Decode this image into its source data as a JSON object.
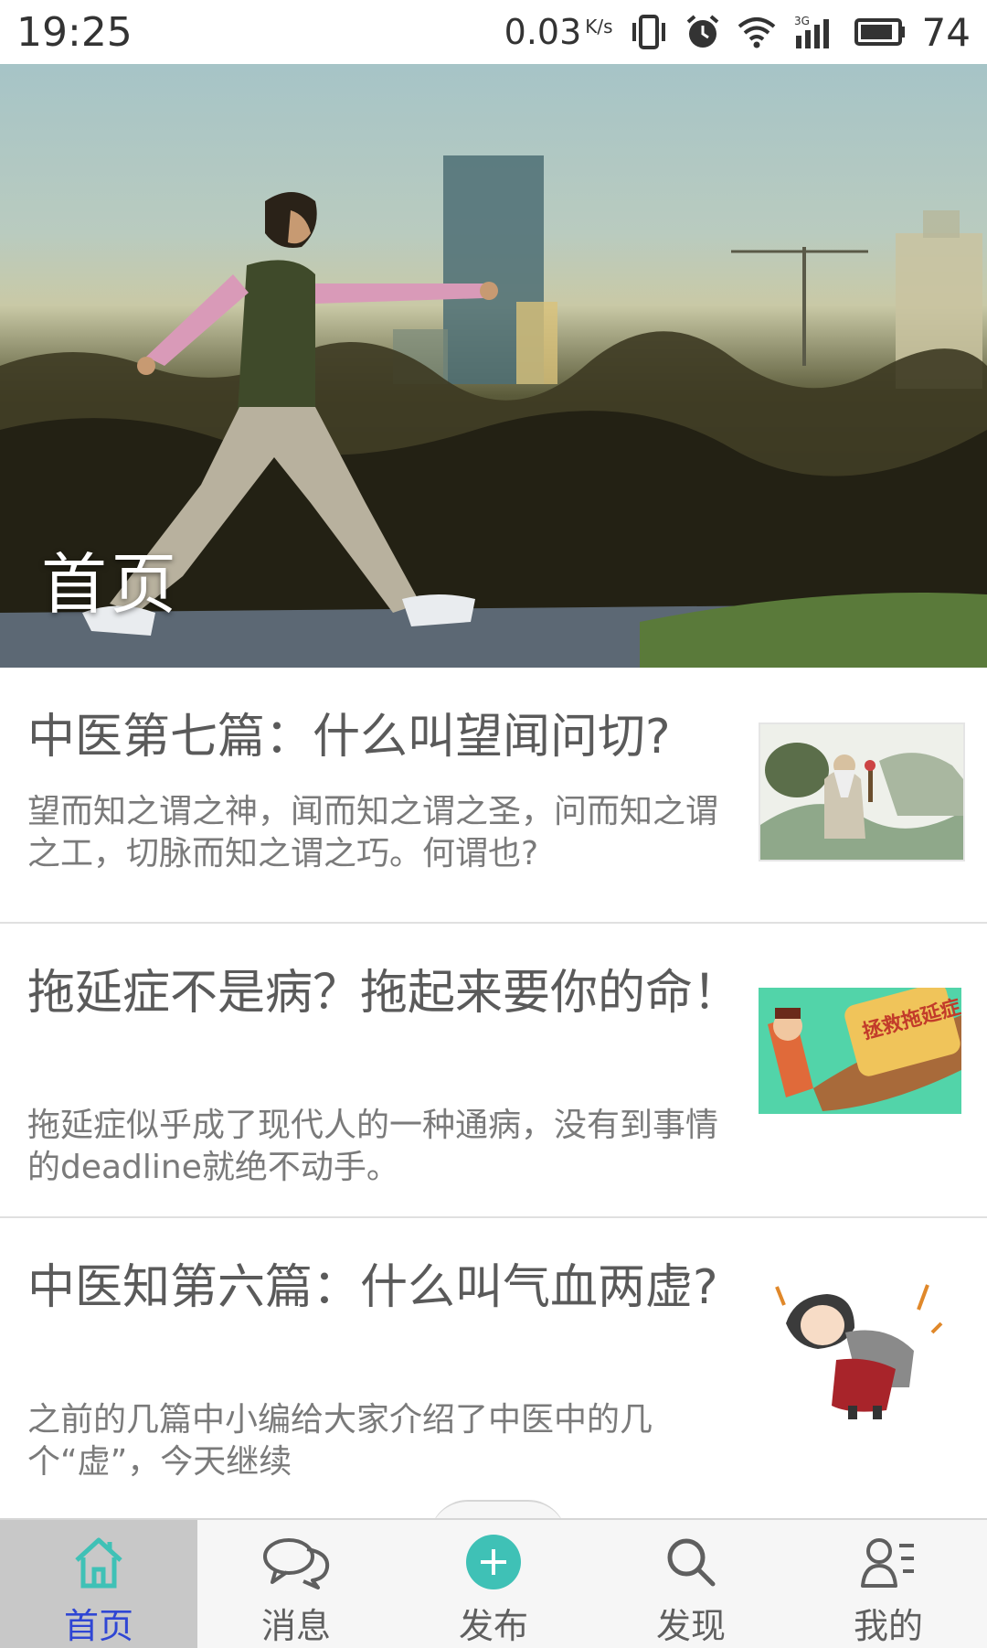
{
  "status_bar": {
    "time": "19:25",
    "net_speed": "0.03",
    "net_speed_unit": "K/s",
    "network_type": "3G",
    "battery": "74",
    "icons": [
      "vibrate-icon",
      "alarm-icon",
      "wifi-icon",
      "signal-icon",
      "battery-icon"
    ]
  },
  "hero": {
    "title": "首页"
  },
  "articles": [
    {
      "title": "中医第七篇：什么叫望闻问切?",
      "summary": "望而知之谓之神，闻而知之谓之圣，问而知之谓之工，切脉而知之谓之巧。何谓也?"
    },
    {
      "title": "拖延症不是病？拖起来要你的命！",
      "summary": "拖延症似乎成了现代人的一种通病，没有到事情的deadline就绝不动手。",
      "thumb_text": "拯救拖延症"
    },
    {
      "title": "中医知第六篇：什么叫气血两虚?",
      "summary": "之前的几篇中小编给大家介绍了中医中的几个“虚”，今天继续"
    }
  ],
  "nav": {
    "items": [
      {
        "label": "首页",
        "icon": "home-icon",
        "active": true
      },
      {
        "label": "消息",
        "icon": "chat-icon",
        "active": false
      },
      {
        "label": "发布",
        "icon": "add-icon",
        "active": false
      },
      {
        "label": "发现",
        "icon": "search-icon",
        "active": false
      },
      {
        "label": "我的",
        "icon": "profile-icon",
        "active": false
      }
    ]
  },
  "colors": {
    "nav_active_text": "#2f46d4",
    "accent_teal": "#3fc1b6",
    "title_text": "#5a5a5a",
    "summary_text": "#7a7a7a"
  }
}
